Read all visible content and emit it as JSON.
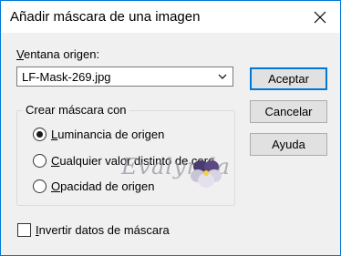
{
  "dialog": {
    "title": "Añadir máscara de una imagen",
    "source_window_label": "Ventana origen:",
    "source_window_value": "LF-Mask-269.jpg",
    "buttons": {
      "accept": "Aceptar",
      "cancel": "Cancelar",
      "help": "Ayuda"
    },
    "group": {
      "title": "Crear máscara con",
      "options": [
        {
          "label": "Luminancia de origen",
          "selected": true
        },
        {
          "label": "Cualquier valor distinto de cero",
          "selected": false
        },
        {
          "label": "Opacidad de origen",
          "selected": false
        }
      ]
    },
    "invert_label": "Invertir datos de máscara",
    "invert_checked": false,
    "watermark": "Evalynda"
  },
  "colors": {
    "accent": "#0078d7",
    "background": "#f0f0f0"
  }
}
